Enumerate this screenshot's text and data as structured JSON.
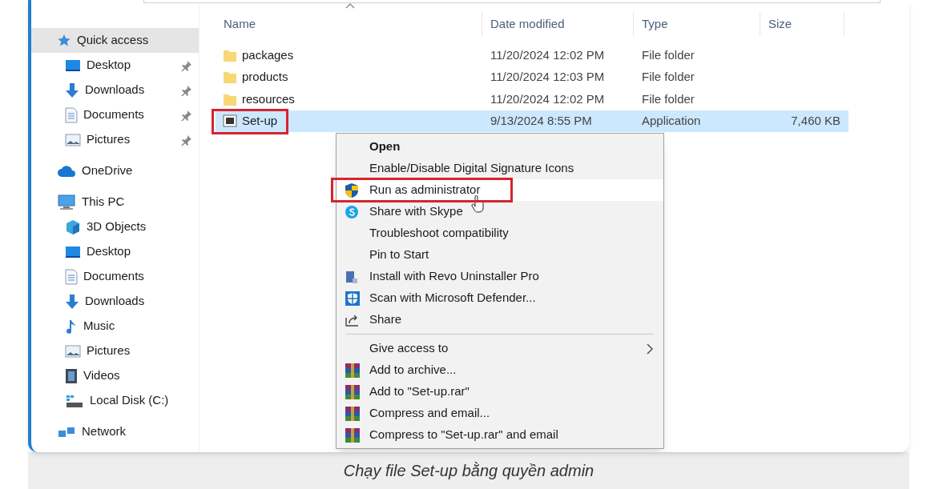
{
  "sidebar": {
    "items": [
      {
        "label": "Quick access",
        "selected": true,
        "children": [
          {
            "label": "Desktop",
            "selected": false,
            "pinned": true
          },
          {
            "label": "Downloads",
            "selected": false,
            "pinned": true
          },
          {
            "label": "Documents",
            "selected": false,
            "pinned": true
          },
          {
            "label": "Pictures",
            "selected": false,
            "pinned": true
          }
        ]
      },
      {
        "label": "OneDrive",
        "selected": false
      },
      {
        "label": "This PC",
        "selected": false,
        "children": [
          {
            "label": "3D Objects",
            "selected": false,
            "pinned": false
          },
          {
            "label": "Desktop",
            "selected": false,
            "pinned": false
          },
          {
            "label": "Documents",
            "selected": false,
            "pinned": false
          },
          {
            "label": "Downloads",
            "selected": false,
            "pinned": false
          },
          {
            "label": "Music",
            "selected": false,
            "pinned": false
          },
          {
            "label": "Pictures",
            "selected": false,
            "pinned": false
          },
          {
            "label": "Videos",
            "selected": false,
            "pinned": false
          },
          {
            "label": "Local Disk (C:)",
            "selected": false,
            "pinned": false
          }
        ]
      },
      {
        "label": "Network",
        "selected": false
      }
    ]
  },
  "files": {
    "columns": [
      "Name",
      "Date modified",
      "Type",
      "Size"
    ],
    "rows": [
      {
        "kind": "folder",
        "name": "packages",
        "date": "11/20/2024 12:02 PM",
        "type": "File folder",
        "size": "",
        "selected": false,
        "boxed": false
      },
      {
        "kind": "folder",
        "name": "products",
        "date": "11/20/2024 12:03 PM",
        "type": "File folder",
        "size": "",
        "selected": false,
        "boxed": false
      },
      {
        "kind": "folder",
        "name": "resources",
        "date": "11/20/2024 12:02 PM",
        "type": "File folder",
        "size": "",
        "selected": false,
        "boxed": false
      },
      {
        "kind": "application",
        "name": "Set-up",
        "date": "9/13/2024 8:55 PM",
        "type": "Application",
        "size": "7,460 KB",
        "selected": true,
        "boxed": true
      }
    ]
  },
  "context_menu": {
    "items": [
      {
        "kind": "item",
        "label": "Open",
        "default": true,
        "hovered": false,
        "boxed": false,
        "submenu": false
      },
      {
        "kind": "item",
        "label": "Enable/Disable Digital Signature Icons",
        "default": false,
        "hovered": false,
        "boxed": false,
        "submenu": false
      },
      {
        "kind": "item",
        "label": "Run as administrator",
        "default": false,
        "hovered": true,
        "boxed": true,
        "submenu": false
      },
      {
        "kind": "item",
        "label": "Share with Skype",
        "default": false,
        "hovered": false,
        "boxed": false,
        "submenu": false
      },
      {
        "kind": "item",
        "label": "Troubleshoot compatibility",
        "default": false,
        "hovered": false,
        "boxed": false,
        "submenu": false
      },
      {
        "kind": "item",
        "label": "Pin to Start",
        "default": false,
        "hovered": false,
        "boxed": false,
        "submenu": false
      },
      {
        "kind": "item",
        "label": "Install with Revo Uninstaller Pro",
        "default": false,
        "hovered": false,
        "boxed": false,
        "submenu": false
      },
      {
        "kind": "item",
        "label": "Scan with Microsoft Defender...",
        "default": false,
        "hovered": false,
        "boxed": false,
        "submenu": false
      },
      {
        "kind": "item",
        "label": "Share",
        "default": false,
        "hovered": false,
        "boxed": false,
        "submenu": false
      },
      {
        "kind": "separator"
      },
      {
        "kind": "item",
        "label": "Give access to",
        "default": false,
        "hovered": false,
        "boxed": false,
        "submenu": true
      },
      {
        "kind": "item",
        "label": "Add to archive...",
        "default": false,
        "hovered": false,
        "boxed": false,
        "submenu": false
      },
      {
        "kind": "item",
        "label": "Add to \"Set-up.rar\"",
        "default": false,
        "hovered": false,
        "boxed": false,
        "submenu": false
      },
      {
        "kind": "item",
        "label": "Compress and email...",
        "default": false,
        "hovered": false,
        "boxed": false,
        "submenu": false
      },
      {
        "kind": "item",
        "label": "Compress to \"Set-up.rar\" and email",
        "default": false,
        "hovered": false,
        "boxed": false,
        "submenu": false
      }
    ]
  },
  "caption": "Chạy file Set-up bằng quyền admin"
}
